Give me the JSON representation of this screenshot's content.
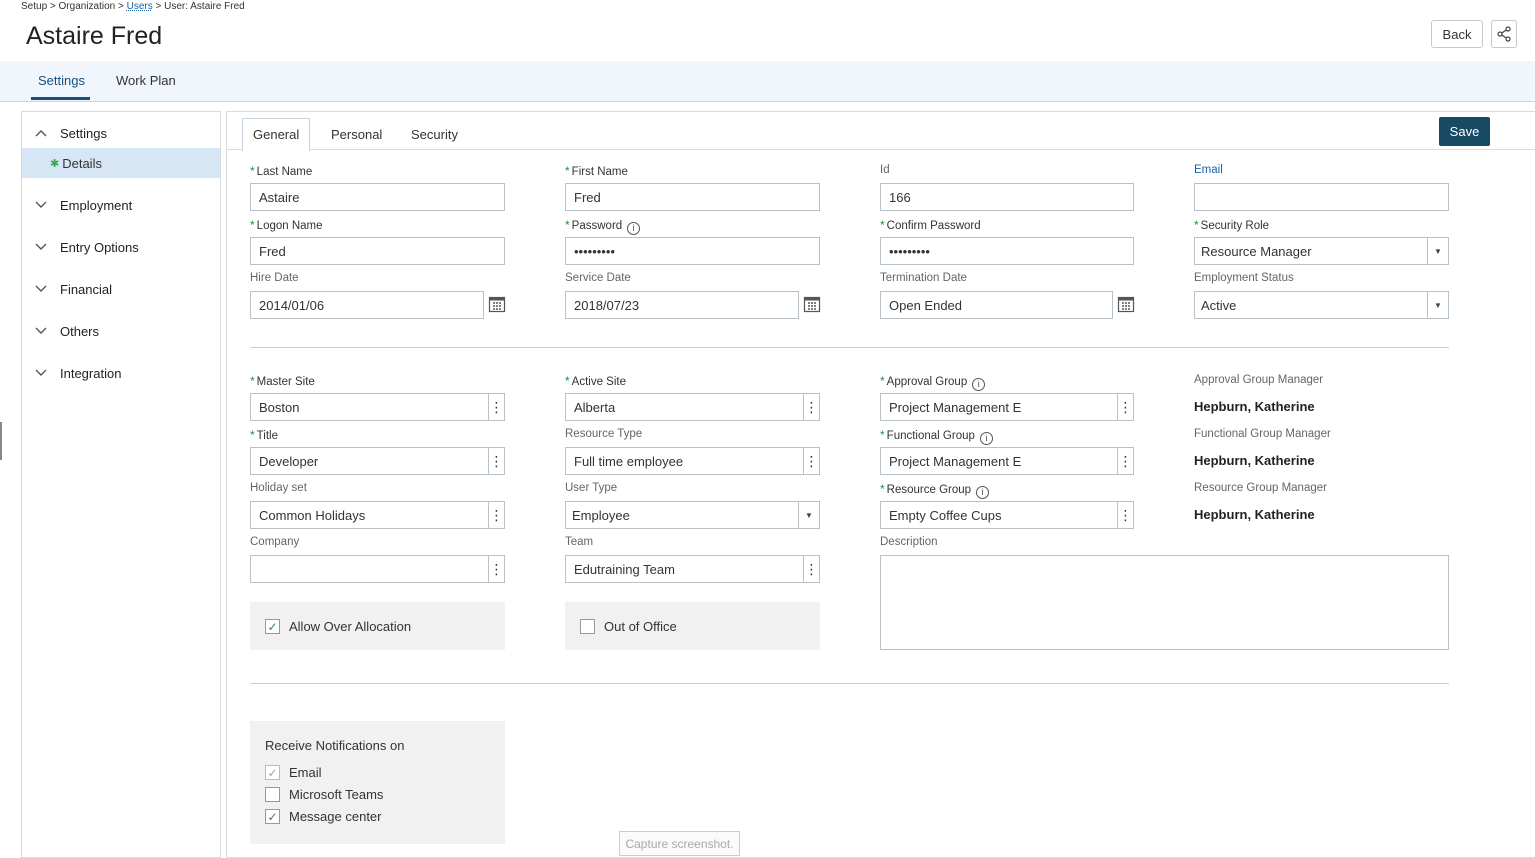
{
  "breadcrumb": {
    "part1": "Setup > Organization > ",
    "users": "Users",
    "part2": " > User: Astaire Fred"
  },
  "page_title": "Astaire Fred",
  "header": {
    "back_label": "Back",
    "share_icon": "share-icon"
  },
  "top_tabs": [
    {
      "label": "Settings",
      "active": true
    },
    {
      "label": "Work Plan",
      "active": false
    }
  ],
  "sidebar": {
    "items": [
      {
        "label": "Settings",
        "expanded": true
      },
      {
        "label": "Employment"
      },
      {
        "label": "Entry Options"
      },
      {
        "label": "Financial"
      },
      {
        "label": "Others"
      },
      {
        "label": "Integration"
      }
    ],
    "sub_item": "Details"
  },
  "sub_tabs": [
    {
      "label": "General",
      "active": true
    },
    {
      "label": "Personal"
    },
    {
      "label": "Security"
    }
  ],
  "save_label": "Save",
  "form": {
    "last_name": {
      "label": "Last Name",
      "value": "Astaire"
    },
    "first_name": {
      "label": "First Name",
      "value": "Fred"
    },
    "id": {
      "label": "Id",
      "value": "166"
    },
    "email": {
      "label": "Email",
      "value": ""
    },
    "logon_name": {
      "label": "Logon Name",
      "value": "Fred"
    },
    "password": {
      "label": "Password",
      "value": "•••••••••"
    },
    "confirm_password": {
      "label": "Confirm Password",
      "value": "•••••••••"
    },
    "security_role": {
      "label": "Security Role",
      "value": "Resource Manager"
    },
    "hire_date": {
      "label": "Hire Date",
      "value": "2014/01/06"
    },
    "service_date": {
      "label": "Service Date",
      "value": "2018/07/23"
    },
    "termination_date": {
      "label": "Termination Date",
      "value": "Open Ended"
    },
    "employment_status": {
      "label": "Employment Status",
      "value": "Active"
    },
    "master_site": {
      "label": "Master Site",
      "value": "Boston"
    },
    "active_site": {
      "label": "Active Site",
      "value": "Alberta"
    },
    "approval_group": {
      "label": "Approval Group",
      "value": "Project Management E"
    },
    "approval_group_manager": {
      "label": "Approval Group Manager",
      "value": "Hepburn, Katherine"
    },
    "title": {
      "label": "Title",
      "value": "Developer"
    },
    "resource_type": {
      "label": "Resource Type",
      "value": "Full time employee"
    },
    "functional_group": {
      "label": "Functional Group",
      "value": "Project Management E"
    },
    "functional_group_manager": {
      "label": "Functional Group Manager",
      "value": "Hepburn, Katherine"
    },
    "holiday_set": {
      "label": "Holiday set",
      "value": "Common Holidays"
    },
    "user_type": {
      "label": "User Type",
      "value": "Employee"
    },
    "resource_group": {
      "label": "Resource Group",
      "value": "Empty Coffee Cups"
    },
    "resource_group_manager": {
      "label": "Resource Group Manager",
      "value": "Hepburn, Katherine"
    },
    "company": {
      "label": "Company",
      "value": ""
    },
    "team": {
      "label": "Team",
      "value": "Edutraining Team"
    },
    "description": {
      "label": "Description",
      "value": ""
    },
    "allow_over_allocation": {
      "label": "Allow Over Allocation",
      "checked": true
    },
    "out_of_office": {
      "label": "Out of Office",
      "checked": false
    }
  },
  "notifications": {
    "title": "Receive Notifications on",
    "options": [
      {
        "label": "Email",
        "checked": true
      },
      {
        "label": "Microsoft Teams",
        "checked": false
      },
      {
        "label": "Message center",
        "checked": true
      }
    ]
  },
  "capture_label": "Capture screenshot."
}
